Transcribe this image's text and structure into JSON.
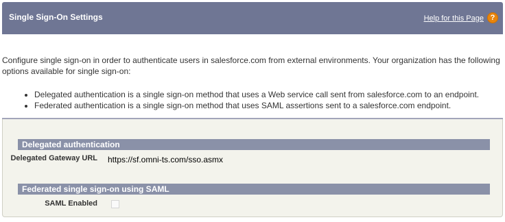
{
  "header": {
    "title": "Single Sign-On Settings",
    "help_link": "Help for this Page",
    "help_icon": "?"
  },
  "intro": "Configure single sign-on in order to authenticate users in salesforce.com from external environments. Your organization has the following options available for single sign-on:",
  "options": [
    "Delegated authentication is a single sign-on method that uses a Web service call sent from salesforce.com to an endpoint.",
    "Federated authentication is a single sign-on method that uses SAML assertions sent to a salesforce.com endpoint."
  ],
  "delegated": {
    "section_title": "Delegated authentication",
    "gateway_label": "Delegated Gateway URL",
    "gateway_value": "https://sf.omni-ts.com/sso.asmx"
  },
  "federated": {
    "section_title": "Federated single sign-on using SAML",
    "saml_label": "SAML Enabled",
    "saml_enabled": false
  }
}
